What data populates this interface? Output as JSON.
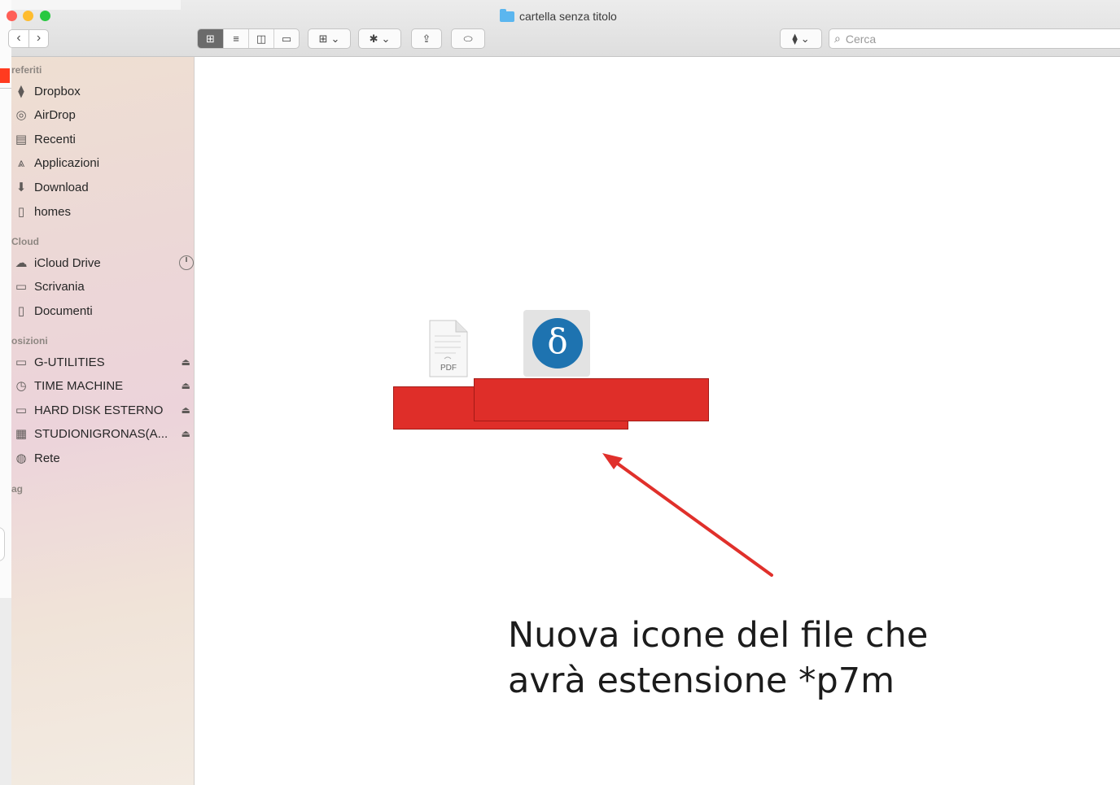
{
  "window": {
    "title": "cartella senza titolo",
    "nav_back": "‹",
    "nav_forward": "›"
  },
  "toolbar": {
    "view_icons": "⊞",
    "view_list": "≡",
    "view_columns": "◫",
    "view_gallery": "▭",
    "group_by": "⊞",
    "action": "✱",
    "share": "⇪",
    "tag": "⬭",
    "dropbox": "⧫",
    "chevron": "⌄",
    "search_placeholder": "Cerca",
    "search_icon": "⌕"
  },
  "sidebar": {
    "sections": {
      "favorites": "referiti",
      "icloud": "Cloud",
      "locations": "osizioni",
      "tags": "ag"
    },
    "favorites": [
      {
        "label": "Dropbox",
        "icon": "dropbox-icon",
        "glyph": "⧫"
      },
      {
        "label": "AirDrop",
        "icon": "airdrop-icon",
        "glyph": "◎"
      },
      {
        "label": "Recenti",
        "icon": "recents-icon",
        "glyph": "▤"
      },
      {
        "label": "Applicazioni",
        "icon": "applications-icon",
        "glyph": "⩓"
      },
      {
        "label": "Download",
        "icon": "download-icon",
        "glyph": "⬇"
      },
      {
        "label": "homes",
        "icon": "document-icon",
        "glyph": "▯"
      }
    ],
    "icloud": [
      {
        "label": "iCloud Drive",
        "icon": "cloud-icon",
        "glyph": "☁"
      },
      {
        "label": "Scrivania",
        "icon": "desktop-icon",
        "glyph": "▭"
      },
      {
        "label": "Documenti",
        "icon": "documents-icon",
        "glyph": "▯"
      }
    ],
    "locations": [
      {
        "label": "G-UTILITIES",
        "icon": "drive-icon",
        "glyph": "▭"
      },
      {
        "label": "TIME MACHINE",
        "icon": "time-machine-icon",
        "glyph": "◷"
      },
      {
        "label": "HARD DISK ESTERNO",
        "icon": "drive-icon",
        "glyph": "▭"
      },
      {
        "label": "STUDIONIGRONAS(A...",
        "icon": "server-icon",
        "glyph": "▦"
      },
      {
        "label": "Rete",
        "icon": "network-icon",
        "glyph": "◍"
      }
    ],
    "eject_glyph": "⏏"
  },
  "content": {
    "pdf_badge": "PDF",
    "p7m_symbol": "δ",
    "annotation_line1": "Nuova icone del file che",
    "annotation_line2": "avrà estensione *p7m"
  },
  "colors": {
    "redaction": "#df2e29",
    "arrow": "#e0302b",
    "p7m_icon": "#1e73b0"
  }
}
